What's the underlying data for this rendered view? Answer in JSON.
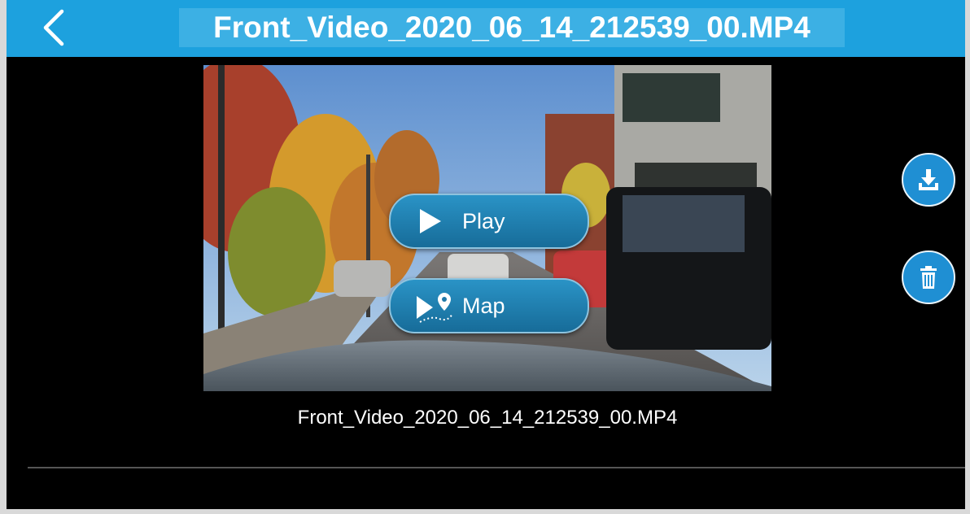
{
  "header": {
    "title": "Front_Video_2020_06_14_212539_00.MP4",
    "back_icon": "chevron-left-icon"
  },
  "video": {
    "play_label": "Play",
    "map_label": "Map",
    "play_icon": "play-icon",
    "map_icon": "route-pin-icon"
  },
  "caption": {
    "filename": "Front_Video_2020_06_14_212539_00.MP4"
  },
  "side_actions": {
    "download_icon": "download-icon",
    "delete_icon": "trash-icon"
  },
  "colors": {
    "header": "#1da1de",
    "title_highlight": "#3cb0e4",
    "button": "#1f8fd3",
    "background": "#000000"
  }
}
